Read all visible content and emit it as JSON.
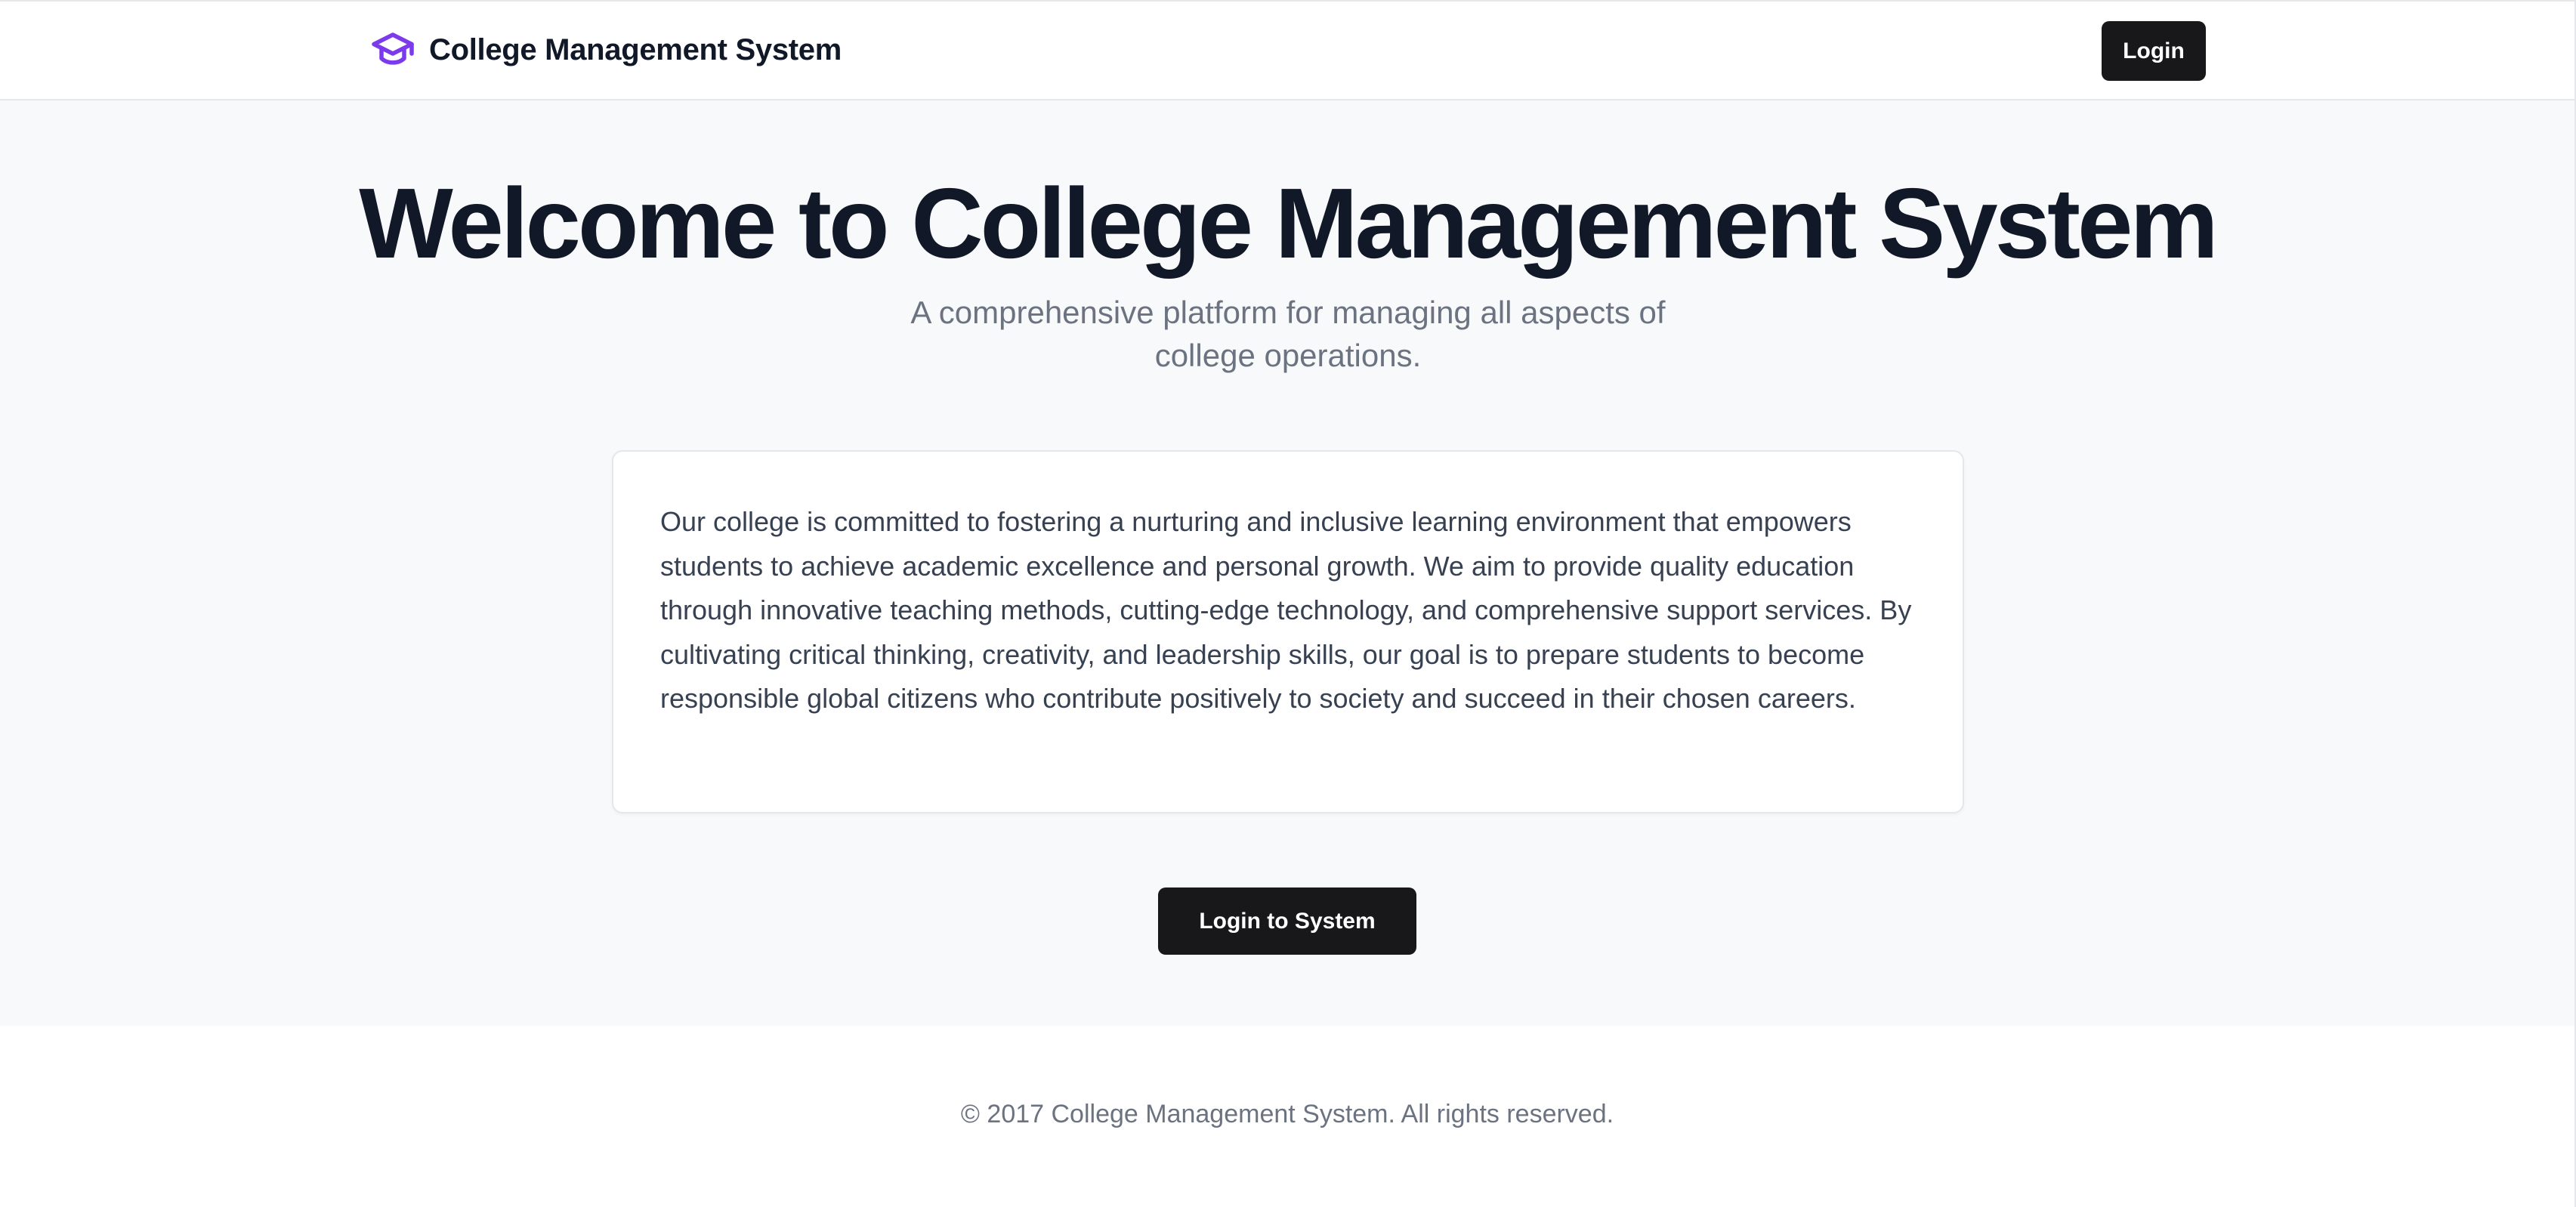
{
  "header": {
    "brand_icon": "graduation-cap-icon",
    "brand_title": "College Management System",
    "login_label": "Login"
  },
  "hero": {
    "title": "Welcome to College Management System",
    "subtitle": "A comprehensive platform for managing all aspects of college operations.",
    "mission": "Our college is committed to fostering a nurturing and inclusive learning environment that empowers students to achieve academic excellence and personal growth. We aim to provide quality education through innovative teaching methods, cutting-edge technology, and comprehensive support services. By cultivating critical thinking, creativity, and leadership skills, our goal is to prepare students to become responsible global citizens who contribute positively to society and succeed in their chosen careers.",
    "cta_label": "Login to System"
  },
  "footer": {
    "copyright": "© 2017 College Management System. All rights reserved."
  },
  "colors": {
    "accent": "#7c3aed",
    "button_bg": "#18181b",
    "hero_bg": "#f8f9fb",
    "text_primary": "#111827",
    "text_muted": "#6b7280"
  }
}
